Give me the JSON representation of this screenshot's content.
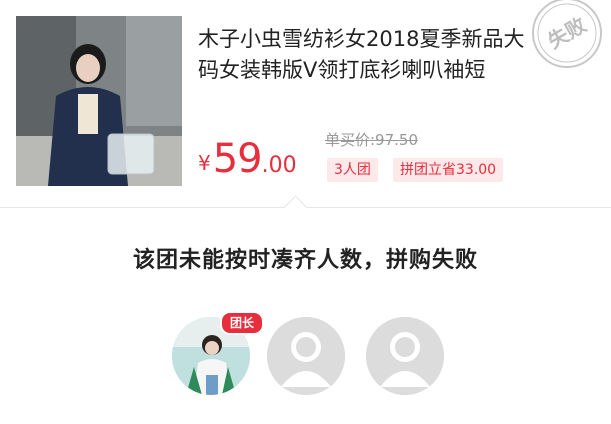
{
  "product": {
    "title": "木子小虫雪纺衫女2018夏季新品大码女装韩版V领打底衫喇叭袖短",
    "original_price": "单买价:97.50",
    "price_currency": "¥",
    "price_int": "59",
    "price_dec": ".00",
    "tags": {
      "group_size": "3人团",
      "savings": "拼团立省33.00"
    },
    "stamp_text": "失败",
    "image_icon": "product-photo"
  },
  "status": {
    "message": "该团未能按时凑齐人数，拼购失败"
  },
  "members": {
    "leader_badge": "团长",
    "slots": [
      {
        "role": "leader",
        "icon": "avatar-photo"
      },
      {
        "role": "empty",
        "icon": "default-avatar-icon"
      },
      {
        "role": "empty",
        "icon": "default-avatar-icon"
      }
    ]
  },
  "colors": {
    "accent": "#e62e3d",
    "tag_bg": "#fde8ea",
    "muted": "#999999"
  }
}
